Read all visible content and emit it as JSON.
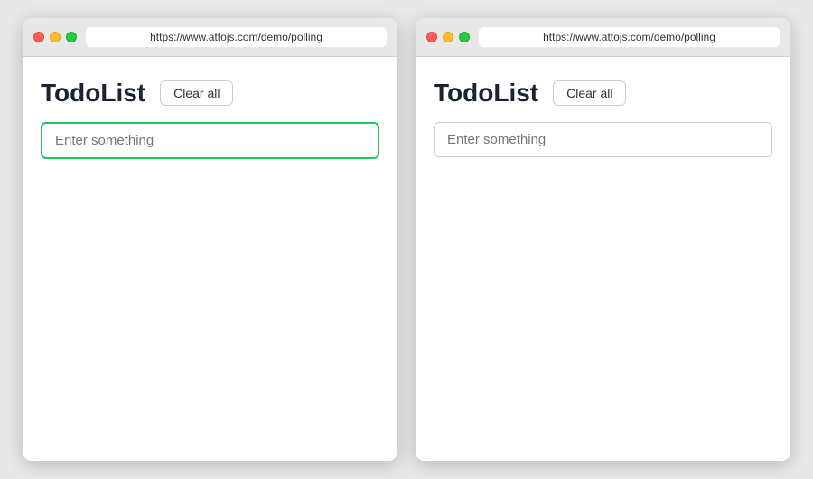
{
  "windows": [
    {
      "id": "window-left",
      "url": "https://www.attojs.com/demo/polling",
      "app": {
        "title": "TodoList",
        "clear_all_label": "Clear all",
        "input_placeholder": "Enter something",
        "input_focused": true
      },
      "traffic_lights": {
        "close_title": "close",
        "minimize_title": "minimize",
        "maximize_title": "maximize"
      }
    },
    {
      "id": "window-right",
      "url": "https://www.attojs.com/demo/polling",
      "app": {
        "title": "TodoList",
        "clear_all_label": "Clear all",
        "input_placeholder": "Enter something",
        "input_focused": false
      },
      "traffic_lights": {
        "close_title": "close",
        "minimize_title": "minimize",
        "maximize_title": "maximize"
      }
    }
  ]
}
